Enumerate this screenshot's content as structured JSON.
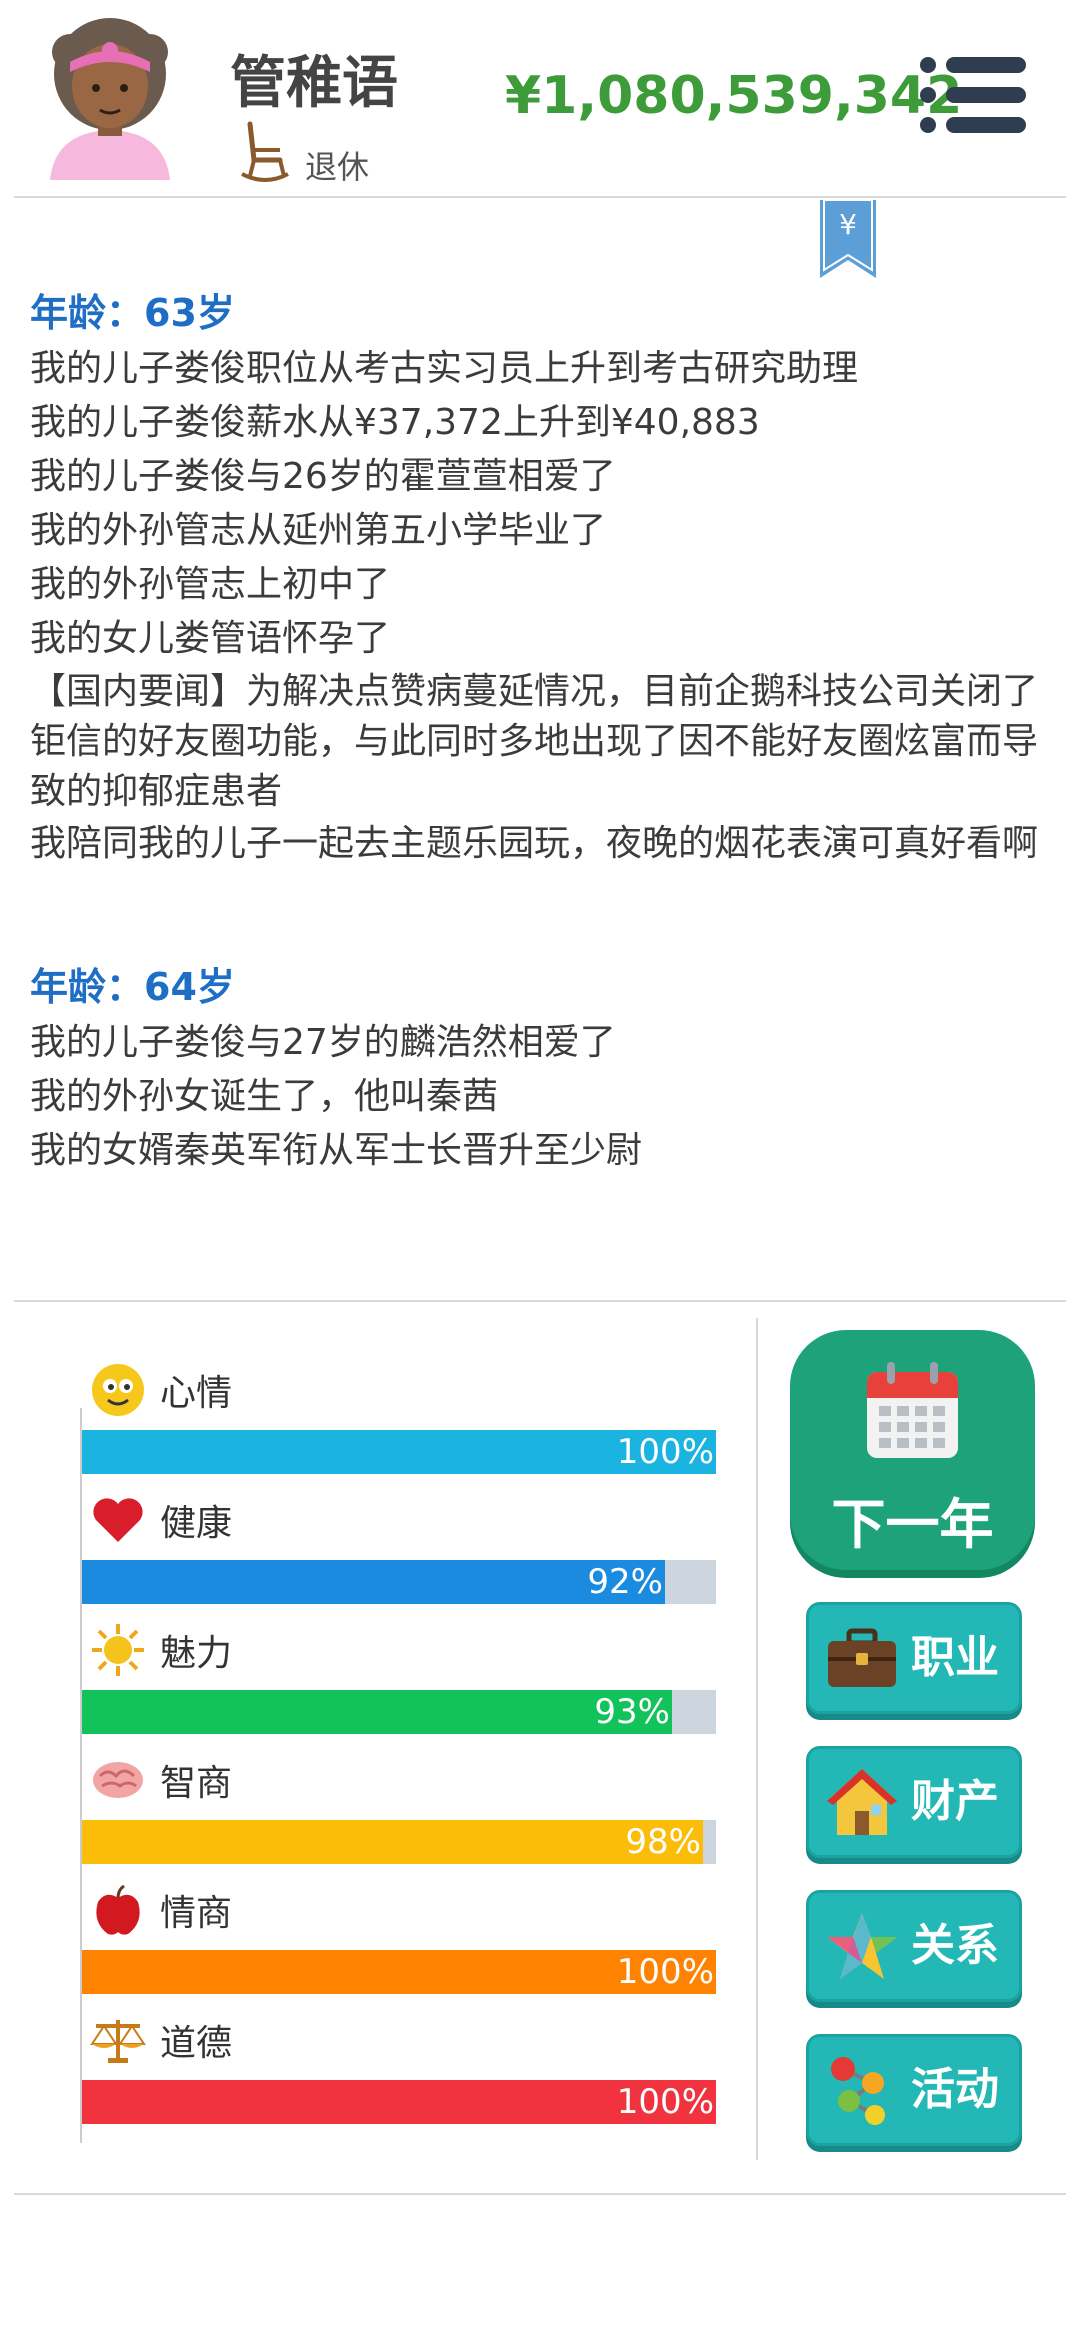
{
  "profile": {
    "name": "管稚语",
    "status": "退休",
    "money": "¥1,080,539,342"
  },
  "icons": {
    "menu": "menu-icon",
    "bookmark": "yen-bookmark-icon"
  },
  "log": {
    "years": [
      {
        "age": "年龄：63岁",
        "events": [
          "我的儿子娄俊职位从考古实习员上升到考古研究助理",
          "我的儿子娄俊薪水从¥37,372上升到¥40,883",
          "我的儿子娄俊与26岁的霍萱萱相爱了",
          "我的外孙管志从延州第五小学毕业了",
          "我的外孙管志上初中了",
          "我的女儿娄管语怀孕了",
          "【国内要闻】为解决点赞病蔓延情况，目前企鹅科技公司关闭了钜信的好友圈功能，与此同时多地出现了因不能好友圈炫富而导致的抑郁症患者",
          "我陪同我的儿子一起去主题乐园玩，夜晚的烟花表演可真好看啊"
        ]
      },
      {
        "age": "年龄：64岁",
        "events": [
          "我的儿子娄俊与27岁的麟浩然相爱了",
          "我的外孙女诞生了，他叫秦茜",
          "我的女婿秦英军衔从军士长晋升至少尉"
        ]
      }
    ]
  },
  "stats": [
    {
      "label": "心情",
      "value": 100,
      "text": "100%",
      "color": "#1bb3e0",
      "icon": "smiley-icon"
    },
    {
      "label": "健康",
      "value": 92,
      "text": "92%",
      "color": "#1b8be0",
      "icon": "heart-icon"
    },
    {
      "label": "魅力",
      "value": 93,
      "text": "93%",
      "color": "#12c25a",
      "icon": "sun-icon"
    },
    {
      "label": "智商",
      "value": 98,
      "text": "98%",
      "color": "#fbbd08",
      "icon": "brain-icon"
    },
    {
      "label": "情商",
      "value": 100,
      "text": "100%",
      "color": "#ff8200",
      "icon": "apple-icon"
    },
    {
      "label": "道德",
      "value": 100,
      "text": "100%",
      "color": "#f0333f",
      "icon": "scales-icon"
    }
  ],
  "buttons": {
    "next_year": "下一年",
    "career": "职业",
    "property": "财产",
    "relations": "关系",
    "activities": "活动"
  }
}
